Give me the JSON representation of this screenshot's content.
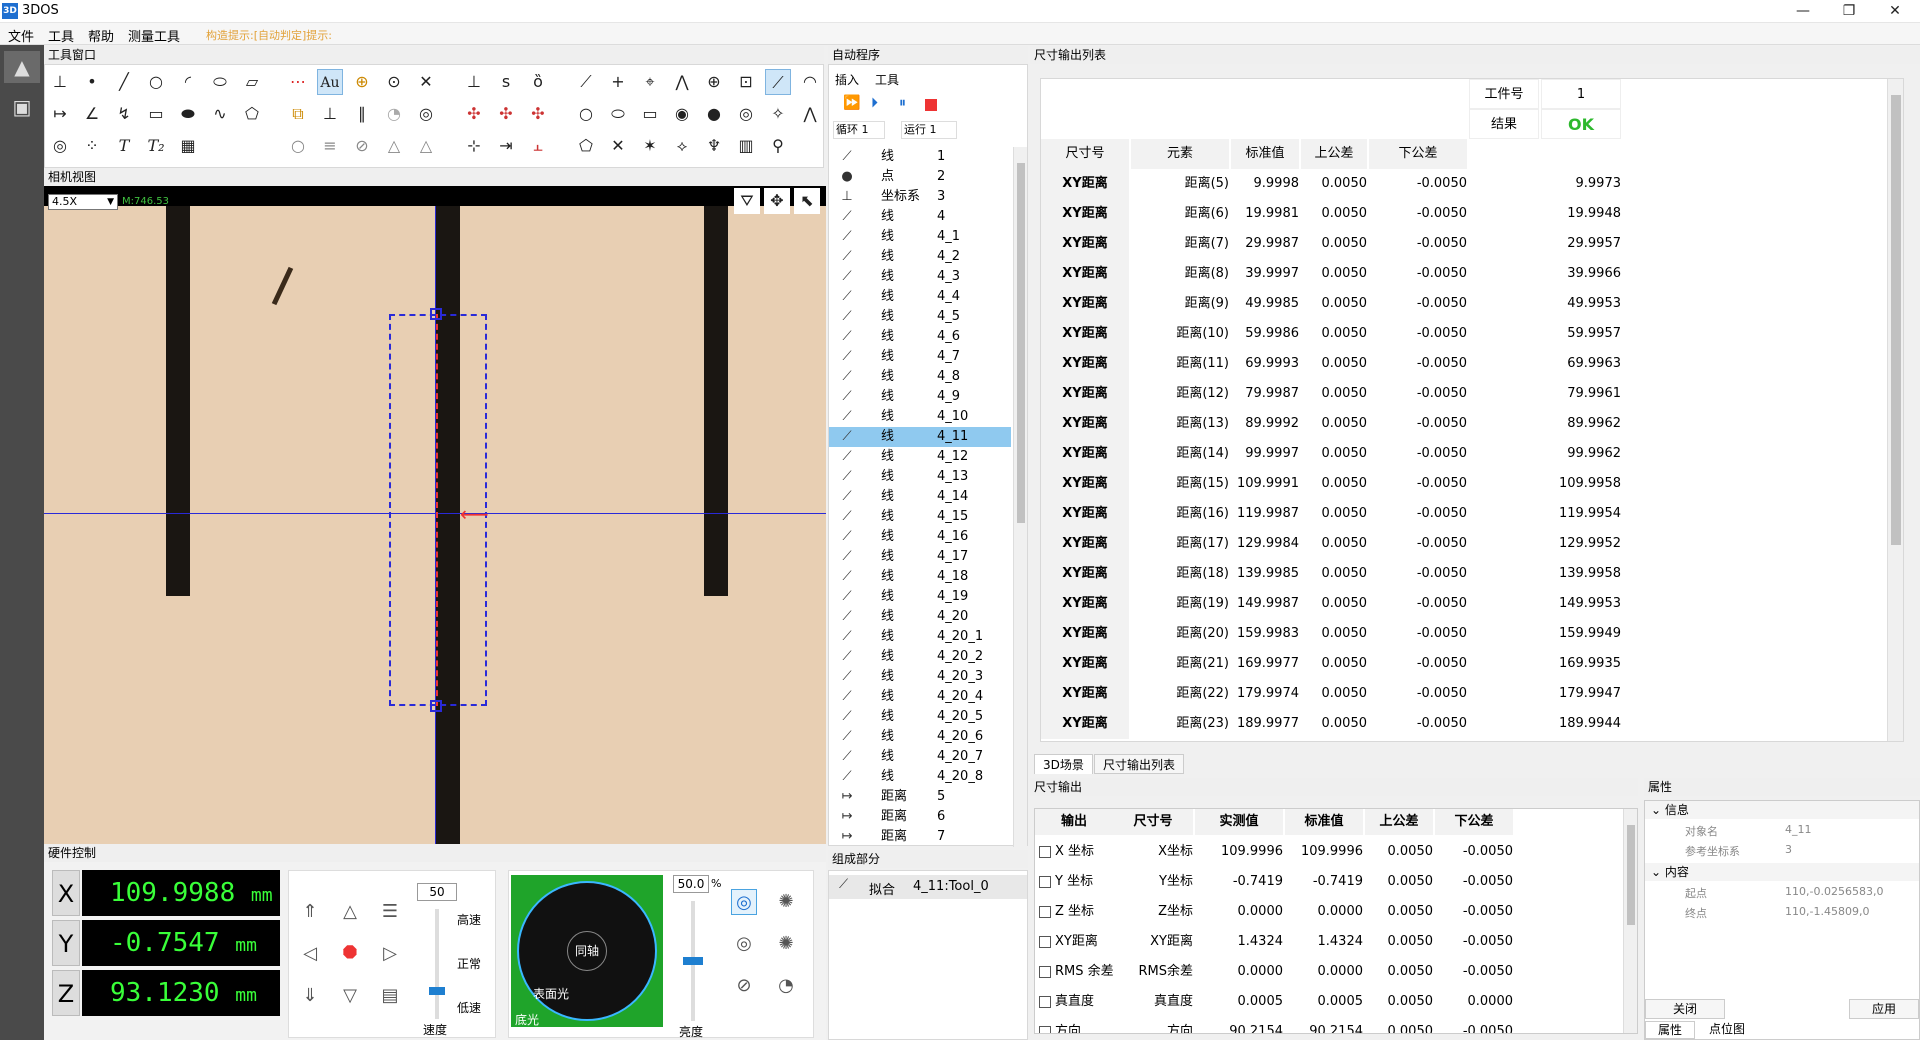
{
  "window": {
    "title": "3DOS",
    "icon": "3D"
  },
  "menu": {
    "items": [
      "文件",
      "工具",
      "帮助",
      "测量工具"
    ],
    "message": "构造提示:[自动判定]提示:"
  },
  "panels": {
    "toolbox": "工具窗口",
    "camera": "相机视图",
    "hardware": "硬件控制",
    "program": "自动程序",
    "program_parts": "组成部分",
    "dim_list": "尺寸输出列表",
    "dim_output": "尺寸输出",
    "properties": "属性"
  },
  "program": {
    "menu": [
      "插入",
      "工具"
    ],
    "loop_label": "循环",
    "loop_value": "1",
    "run_label": "运行",
    "run_value": "1",
    "rows": [
      {
        "icon": "line-icon",
        "type": "线",
        "id": "1"
      },
      {
        "icon": "point-icon",
        "type": "点",
        "id": "2"
      },
      {
        "icon": "coordinate-system-icon",
        "type": "坐标系",
        "id": "3"
      },
      {
        "icon": "line-icon",
        "type": "线",
        "id": "4"
      },
      {
        "icon": "line-icon",
        "type": "线",
        "id": "4_1"
      },
      {
        "icon": "line-icon",
        "type": "线",
        "id": "4_2"
      },
      {
        "icon": "line-icon",
        "type": "线",
        "id": "4_3"
      },
      {
        "icon": "line-icon",
        "type": "线",
        "id": "4_4"
      },
      {
        "icon": "line-icon",
        "type": "线",
        "id": "4_5"
      },
      {
        "icon": "line-icon",
        "type": "线",
        "id": "4_6"
      },
      {
        "icon": "line-icon",
        "type": "线",
        "id": "4_7"
      },
      {
        "icon": "line-icon",
        "type": "线",
        "id": "4_8"
      },
      {
        "icon": "line-icon",
        "type": "线",
        "id": "4_9"
      },
      {
        "icon": "line-icon",
        "type": "线",
        "id": "4_10"
      },
      {
        "icon": "line-icon",
        "type": "线",
        "id": "4_11",
        "selected": true
      },
      {
        "icon": "line-icon",
        "type": "线",
        "id": "4_12"
      },
      {
        "icon": "line-icon",
        "type": "线",
        "id": "4_13"
      },
      {
        "icon": "line-icon",
        "type": "线",
        "id": "4_14"
      },
      {
        "icon": "line-icon",
        "type": "线",
        "id": "4_15"
      },
      {
        "icon": "line-icon",
        "type": "线",
        "id": "4_16"
      },
      {
        "icon": "line-icon",
        "type": "线",
        "id": "4_17"
      },
      {
        "icon": "line-icon",
        "type": "线",
        "id": "4_18"
      },
      {
        "icon": "line-icon",
        "type": "线",
        "id": "4_19"
      },
      {
        "icon": "line-icon",
        "type": "线",
        "id": "4_20"
      },
      {
        "icon": "line-icon",
        "type": "线",
        "id": "4_20_1"
      },
      {
        "icon": "line-icon",
        "type": "线",
        "id": "4_20_2"
      },
      {
        "icon": "line-icon",
        "type": "线",
        "id": "4_20_3"
      },
      {
        "icon": "line-icon",
        "type": "线",
        "id": "4_20_4"
      },
      {
        "icon": "line-icon",
        "type": "线",
        "id": "4_20_5"
      },
      {
        "icon": "line-icon",
        "type": "线",
        "id": "4_20_6"
      },
      {
        "icon": "line-icon",
        "type": "线",
        "id": "4_20_7"
      },
      {
        "icon": "line-icon",
        "type": "线",
        "id": "4_20_8"
      },
      {
        "icon": "distance-icon",
        "type": "距离",
        "id": "5"
      },
      {
        "icon": "distance-icon",
        "type": "距离",
        "id": "6"
      },
      {
        "icon": "distance-icon",
        "type": "距离",
        "id": "7"
      }
    ],
    "parts": [
      {
        "type": "拟合",
        "name": "4_11:Tool_0"
      }
    ]
  },
  "camera": {
    "zoom": "4.5X",
    "coord": "M:746.53"
  },
  "hardware": {
    "x": "109.9988",
    "y": "-0.7547",
    "z": "93.1230",
    "unit": "mm",
    "speed_value": "50",
    "speed_high": "高速",
    "speed_normal": "正常",
    "speed_low": "低速",
    "speed_label": "速度",
    "light_coax": "同轴",
    "light_surface": "表面光",
    "light_bottom": "底光",
    "brightness_value": "50.0",
    "brightness_unit": "%",
    "brightness_label": "亮度"
  },
  "dim_list": {
    "workpiece_label": "工件号",
    "workpiece_value": "1",
    "result_label": "结果",
    "result_value": "OK",
    "headers": [
      "尺寸号",
      "元素",
      "标准值",
      "上公差",
      "下公差"
    ],
    "rows": [
      [
        "XY距离",
        "距离(5)",
        "9.9998",
        "0.0050",
        "-0.0050",
        "9.9973"
      ],
      [
        "XY距离",
        "距离(6)",
        "19.9981",
        "0.0050",
        "-0.0050",
        "19.9948"
      ],
      [
        "XY距离",
        "距离(7)",
        "29.9987",
        "0.0050",
        "-0.0050",
        "29.9957"
      ],
      [
        "XY距离",
        "距离(8)",
        "39.9997",
        "0.0050",
        "-0.0050",
        "39.9966"
      ],
      [
        "XY距离",
        "距离(9)",
        "49.9985",
        "0.0050",
        "-0.0050",
        "49.9953"
      ],
      [
        "XY距离",
        "距离(10)",
        "59.9986",
        "0.0050",
        "-0.0050",
        "59.9957"
      ],
      [
        "XY距离",
        "距离(11)",
        "69.9993",
        "0.0050",
        "-0.0050",
        "69.9963"
      ],
      [
        "XY距离",
        "距离(12)",
        "79.9987",
        "0.0050",
        "-0.0050",
        "79.9961"
      ],
      [
        "XY距离",
        "距离(13)",
        "89.9992",
        "0.0050",
        "-0.0050",
        "89.9962"
      ],
      [
        "XY距离",
        "距离(14)",
        "99.9997",
        "0.0050",
        "-0.0050",
        "99.9962"
      ],
      [
        "XY距离",
        "距离(15)",
        "109.9991",
        "0.0050",
        "-0.0050",
        "109.9958"
      ],
      [
        "XY距离",
        "距离(16)",
        "119.9987",
        "0.0050",
        "-0.0050",
        "119.9954"
      ],
      [
        "XY距离",
        "距离(17)",
        "129.9984",
        "0.0050",
        "-0.0050",
        "129.9952"
      ],
      [
        "XY距离",
        "距离(18)",
        "139.9985",
        "0.0050",
        "-0.0050",
        "139.9958"
      ],
      [
        "XY距离",
        "距离(19)",
        "149.9987",
        "0.0050",
        "-0.0050",
        "149.9953"
      ],
      [
        "XY距离",
        "距离(20)",
        "159.9983",
        "0.0050",
        "-0.0050",
        "159.9949"
      ],
      [
        "XY距离",
        "距离(21)",
        "169.9977",
        "0.0050",
        "-0.0050",
        "169.9935"
      ],
      [
        "XY距离",
        "距离(22)",
        "179.9974",
        "0.0050",
        "-0.0050",
        "179.9947"
      ],
      [
        "XY距离",
        "距离(23)",
        "189.9977",
        "0.0050",
        "-0.0050",
        "189.9944"
      ]
    ],
    "tabs": [
      "3D场景",
      "尺寸输出列表"
    ]
  },
  "dim_output": {
    "headers": [
      "输出",
      "尺寸号",
      "实测值",
      "标准值",
      "上公差",
      "下公差"
    ],
    "rows": [
      [
        "X 坐标",
        "X坐标",
        "109.9996",
        "109.9996",
        "0.0050",
        "-0.0050"
      ],
      [
        "Y 坐标",
        "Y坐标",
        "-0.7419",
        "-0.7419",
        "0.0050",
        "-0.0050"
      ],
      [
        "Z 坐标",
        "Z坐标",
        "0.0000",
        "0.0000",
        "0.0050",
        "-0.0050"
      ],
      [
        "XY距离",
        "XY距离",
        "1.4324",
        "1.4324",
        "0.0050",
        "-0.0050"
      ],
      [
        "RMS 余差",
        "RMS余差",
        "0.0000",
        "0.0000",
        "0.0050",
        "-0.0050"
      ],
      [
        "真直度",
        "真直度",
        "0.0005",
        "0.0005",
        "0.0050",
        "0.0000"
      ],
      [
        "方向",
        "方向",
        "90.2154",
        "90.2154",
        "0.0050",
        "-0.0050"
      ]
    ]
  },
  "properties": {
    "group_info": "信息",
    "object_name_label": "对象名",
    "object_name_value": "4_11",
    "ref_cs_label": "参考坐标系",
    "ref_cs_value": "3",
    "group_content": "内容",
    "start_label": "起点",
    "start_value": "110,-0.0256583,0",
    "end_label": "终点",
    "end_value": "110,-1.45809,0",
    "close_button": "关闭",
    "apply_button": "应用",
    "tabs": [
      "属性",
      "点位图"
    ]
  },
  "colors": {
    "accent": "#1e6fd0",
    "ok": "#2db82d",
    "selection": "#8fc9ef",
    "readout": "#39ff39",
    "camera_bg": "#e8cfb3"
  }
}
